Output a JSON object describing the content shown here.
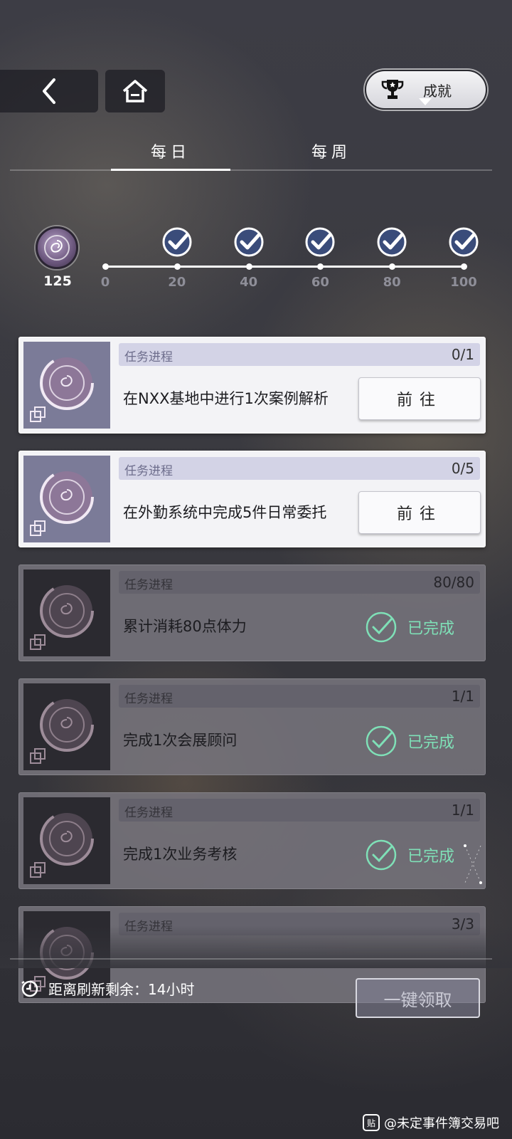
{
  "header": {
    "back_icon": "chevron-left-icon",
    "home_icon": "home-icon",
    "achievements_label": "成就",
    "achievements_icon": "trophy-icon"
  },
  "tabs": [
    {
      "label": "每日",
      "selected": true
    },
    {
      "label": "每周",
      "selected": false
    }
  ],
  "progress": {
    "points": "125",
    "ticks": [
      "0",
      "20",
      "40",
      "60",
      "80",
      "100"
    ],
    "milestones_claimed": [
      true,
      true,
      true,
      true,
      true
    ],
    "colors": {
      "milestone": "#3a4c7a",
      "track": "#ffffff"
    }
  },
  "tasks": [
    {
      "progress_label": "任务进程",
      "progress": "0/1",
      "title": "在NXX基地中进行1次案例解析",
      "action": "前往",
      "status": "active"
    },
    {
      "progress_label": "任务进程",
      "progress": "0/5",
      "title": "在外勤系统中完成5件日常委托",
      "action": "前往",
      "status": "active"
    },
    {
      "progress_label": "任务进程",
      "progress": "80/80",
      "title": "累计消耗80点体力",
      "action": "已完成",
      "status": "done"
    },
    {
      "progress_label": "任务进程",
      "progress": "1/1",
      "title": "完成1次会展顾问",
      "action": "已完成",
      "status": "done"
    },
    {
      "progress_label": "任务进程",
      "progress": "1/1",
      "title": "完成1次业务考核",
      "action": "已完成",
      "status": "done"
    },
    {
      "progress_label": "任务进程",
      "progress": "3/3",
      "title": "",
      "action": "",
      "status": "done"
    }
  ],
  "footer": {
    "timer_text": "距离刷新剩余：14小时",
    "timer_icon": "clock-icon",
    "claim_all_label": "一键领取"
  },
  "watermark": {
    "logo_text": "贴",
    "text": "@未定事件簿交易吧"
  },
  "colors": {
    "done_green": "#7fe0b7",
    "active_card": "#f3f3f6",
    "done_card": "#78767e"
  }
}
